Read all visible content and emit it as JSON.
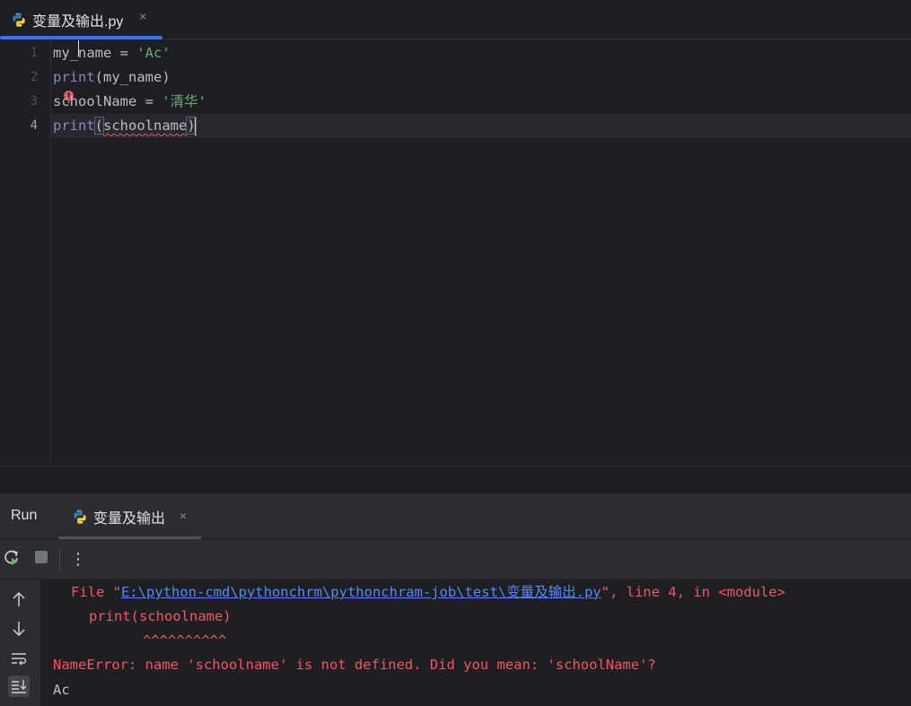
{
  "editor_tab": {
    "label": "变量及输出.py",
    "close": "×"
  },
  "code": {
    "line_numbers": [
      "1",
      "2",
      "3",
      "4"
    ],
    "line1": {
      "var": "my_name",
      "op": " = ",
      "str": "'Ac'"
    },
    "line2": {
      "fn": "print",
      "args": "(my_name)"
    },
    "line3": {
      "var": "schoolName",
      "op": " = ",
      "str": "'清华'"
    },
    "line4": {
      "fn": "print",
      "open": "(",
      "arg": "schoolname",
      "close": ")"
    }
  },
  "run_panel": {
    "title": "Run",
    "tab_label": "变量及输出",
    "tab_close": "×",
    "more": "⋮"
  },
  "console": {
    "file_prefix": "File \"",
    "file_path": "E:\\python-cmd\\pythonchrm\\pythonchram-job\\test\\变量及输出.py",
    "file_suffix": "\", line 4, in <module>",
    "code_line": "print(schoolname)",
    "carets": "^^^^^^^^^^",
    "error": "NameError: name 'schoolname' is not defined. Did you mean: 'schoolName'?",
    "output": "Ac"
  },
  "colors": {
    "accent": "#3574f0",
    "error": "#f75464",
    "string": "#6aab73",
    "builtin": "#8888c6",
    "link": "#548af7"
  },
  "icons": [
    "python-file-icon",
    "rerun-icon",
    "stop-icon",
    "more-icon",
    "arrow-up-icon",
    "arrow-down-icon",
    "soft-wrap-icon",
    "scroll-to-end-icon",
    "error-marker-icon"
  ]
}
